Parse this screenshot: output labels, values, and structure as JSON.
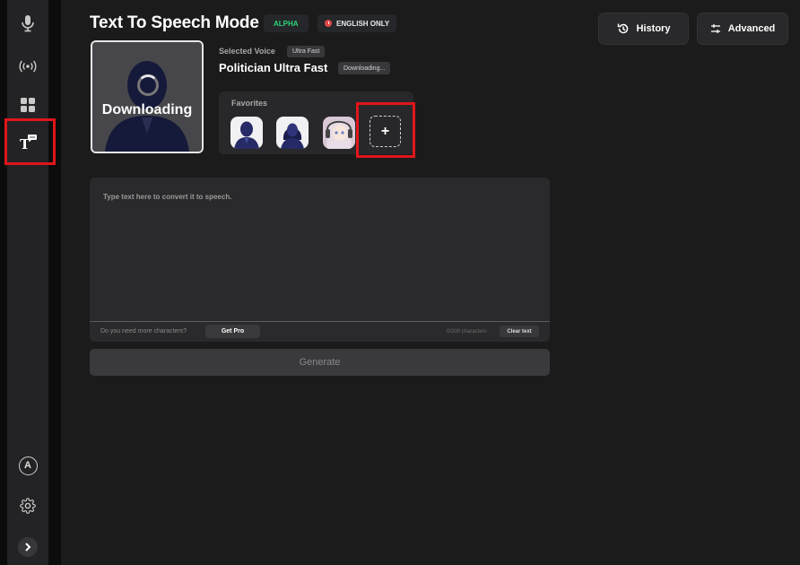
{
  "sidebar": {
    "items": [
      {
        "icon": "microphone-icon"
      },
      {
        "icon": "broadcast-icon"
      },
      {
        "icon": "grid-icon"
      },
      {
        "icon": "text-to-speech-icon"
      }
    ],
    "bottom": [
      {
        "icon": "account-icon",
        "label": "A"
      },
      {
        "icon": "gear-icon"
      },
      {
        "icon": "chevron-right-icon"
      }
    ]
  },
  "header": {
    "title": "Text To Speech Mode",
    "alpha_badge": "ALPHA",
    "english_badge": "ENGLISH ONLY",
    "history_label": "History",
    "advanced_label": "Advanced"
  },
  "voice": {
    "avatar_status": "Downloading",
    "selected_label": "Selected Voice",
    "speed_tag": "Ultra Fast",
    "name": "Politician Ultra Fast",
    "status_tag": "Downloading...",
    "favorites_label": "Favorites",
    "add_label": "+"
  },
  "editor": {
    "placeholder": "Type text here to convert it to speech.",
    "more_chars": "Do you need more characters?",
    "get_pro": "Get Pro",
    "char_count": "0/200 characters",
    "clear_text": "Clear text",
    "generate": "Generate"
  },
  "colors": {
    "background": "#1b1b1c",
    "accent_alpha": "#2bd37b",
    "warning_dot": "#e04848",
    "highlight": "#e0161b"
  }
}
